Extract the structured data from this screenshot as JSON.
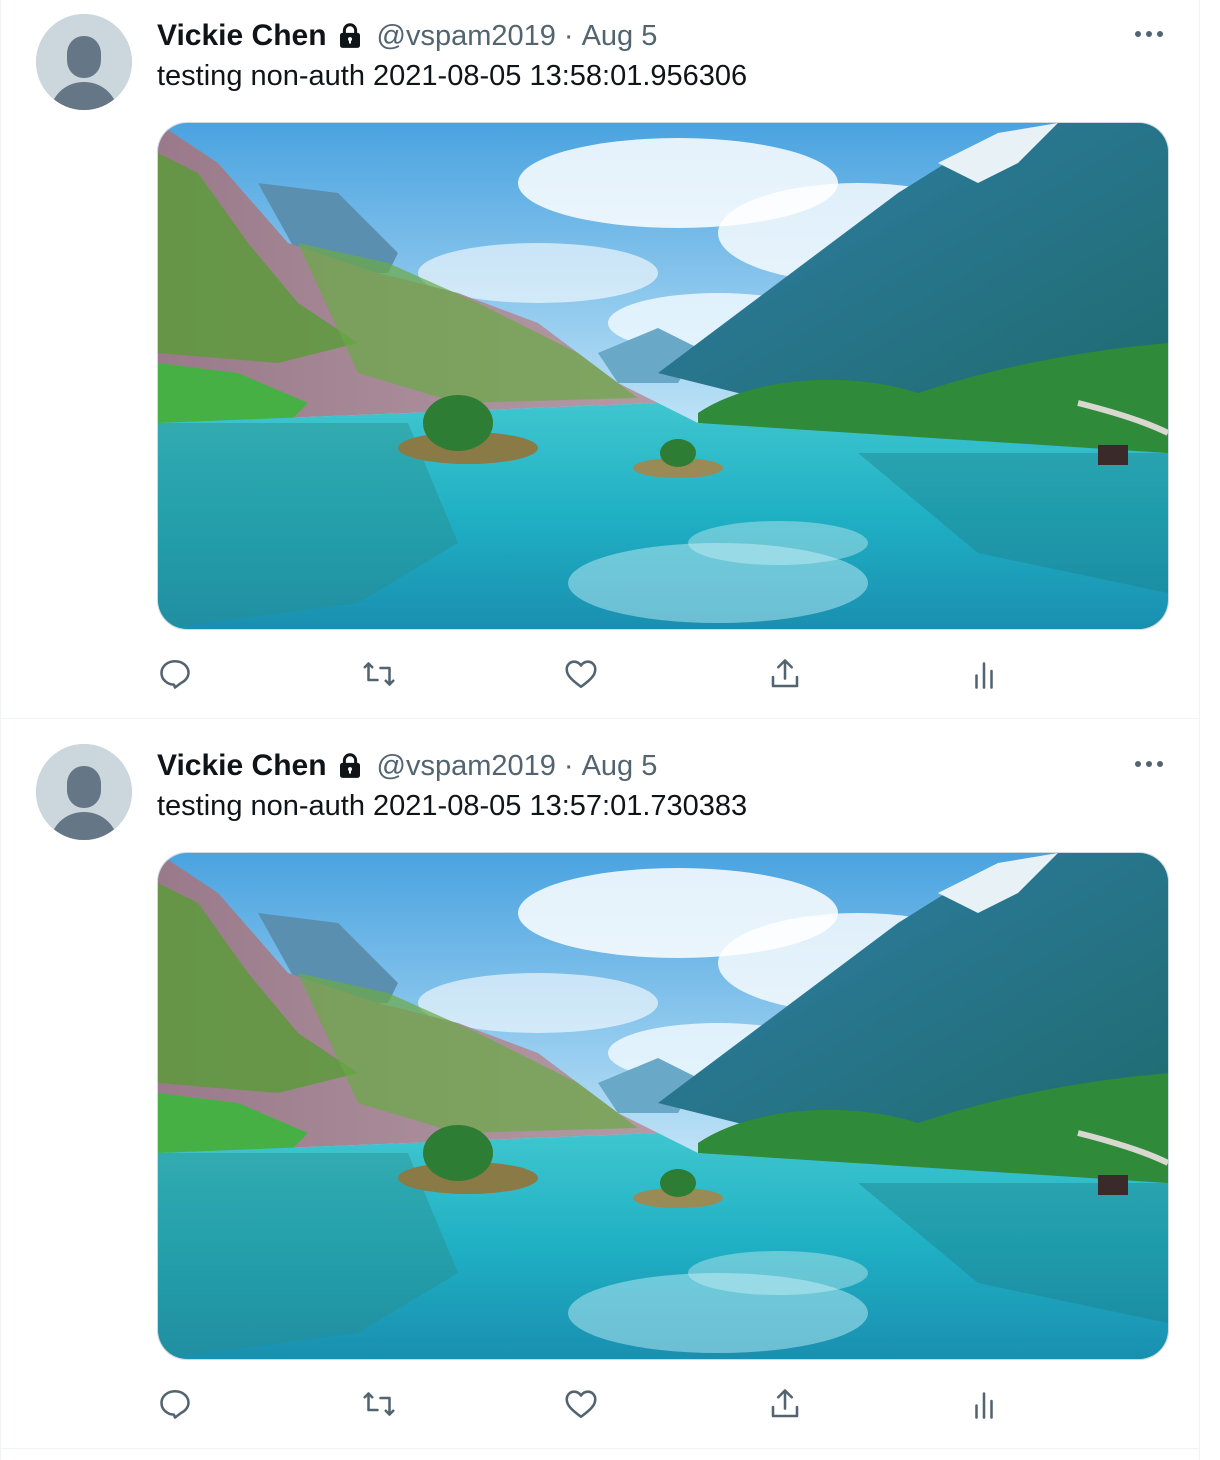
{
  "tweets": [
    {
      "author_name": "Vickie Chen",
      "handle": "@vspam2019",
      "separator": "·",
      "date": "Aug 5",
      "text": "testing non-auth 2021-08-05 13:58:01.956306",
      "protected_icon": "lock-icon",
      "media": "fjord-landscape-photo",
      "actions": [
        "reply-icon",
        "retweet-icon",
        "like-icon",
        "share-icon",
        "analytics-icon"
      ]
    },
    {
      "author_name": "Vickie Chen",
      "handle": "@vspam2019",
      "separator": "·",
      "date": "Aug 5",
      "text": "testing non-auth 2021-08-05 13:57:01.730383",
      "protected_icon": "lock-icon",
      "media": "fjord-landscape-photo",
      "actions": [
        "reply-icon",
        "retweet-icon",
        "like-icon",
        "share-icon",
        "analytics-icon"
      ]
    }
  ],
  "colors": {
    "text_primary": "#0f1419",
    "text_secondary": "#536471",
    "border": "#eff3f4",
    "avatar_bg": "#ccd6dd",
    "avatar_fg": "#657786"
  }
}
